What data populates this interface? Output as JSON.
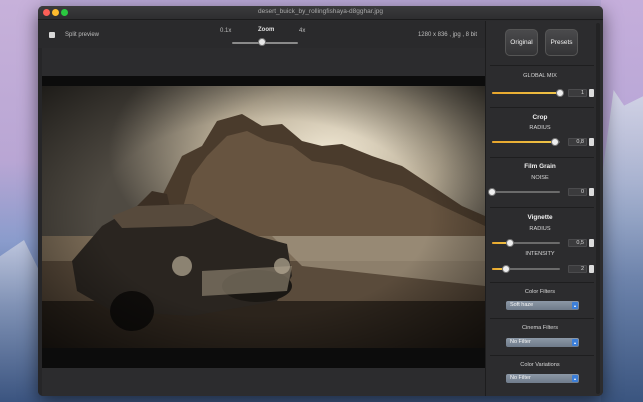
{
  "window": {
    "title": "desert_buick_by_rollingfishaya-d8gghar.jpg"
  },
  "toolbar": {
    "split_preview_label": "Split preview",
    "zoom_label": "Zoom",
    "zoom_min": "0.1x",
    "zoom_max": "4x",
    "zoom_level": 0.45,
    "image_info": "1280 x 836 , jpg , 8 bit"
  },
  "sidebar": {
    "original_label": "Original",
    "presets_label": "Presets",
    "global_mix": {
      "label": "GLOBAL MIX",
      "value": "1",
      "level": 1.0
    },
    "crop": {
      "title": "Crop",
      "param": "RADIUS",
      "value": "0,8",
      "level": 0.93
    },
    "film_grain": {
      "title": "Film Grain",
      "param": "NOISE",
      "value": "0",
      "level": 0.0
    },
    "vignette": {
      "title": "Vignette",
      "radius_label": "RADIUS",
      "radius_value": "0,5",
      "radius_level": 0.27,
      "intensity_label": "INTENSITY",
      "intensity_value": "2",
      "intensity_level": 0.2
    },
    "color_filters": {
      "title": "Color Filters",
      "selected": "Soft haze"
    },
    "cinema_filters": {
      "title": "Cinema Filters",
      "selected": "No Filter"
    },
    "color_variations": {
      "title": "Color Variations",
      "selected": "No Filter"
    }
  },
  "colors": {
    "slider_fill": "#f0b83a",
    "select_caret": "#3c7fd9"
  }
}
